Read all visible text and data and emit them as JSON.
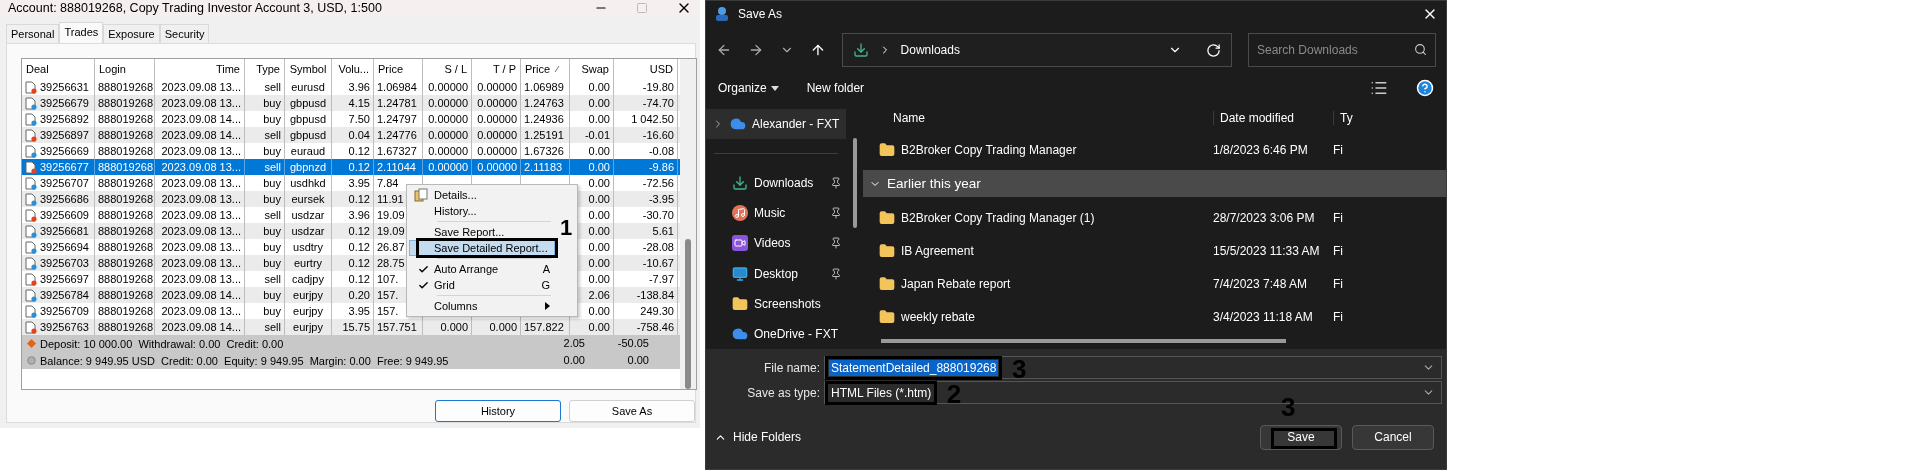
{
  "account_window": {
    "title": "Account: 888019268, Copy Trading Investor Account 3, USD, 1:500",
    "tabs": [
      {
        "label": "Personal",
        "selected": false
      },
      {
        "label": "Trades",
        "selected": true
      },
      {
        "label": "Exposure",
        "selected": false
      },
      {
        "label": "Security",
        "selected": false
      }
    ],
    "table": {
      "columns": [
        {
          "label": "Deal",
          "sorted": false
        },
        {
          "label": "Login",
          "sorted": false
        },
        {
          "label": "Time",
          "sorted": false
        },
        {
          "label": "Type",
          "sorted": false
        },
        {
          "label": "Symbol",
          "sorted": false
        },
        {
          "label": "Volu...",
          "sorted": false
        },
        {
          "label": "Price",
          "sorted": false
        },
        {
          "label": "S / L",
          "sorted": false
        },
        {
          "label": "T / P",
          "sorted": false
        },
        {
          "label": "Price",
          "sorted": true
        },
        {
          "label": "Swap",
          "sorted": false
        },
        {
          "label": "USD",
          "sorted": false
        }
      ],
      "rows": [
        {
          "selected": false,
          "color": "#e0461c",
          "cells": [
            "39256631",
            "888019268",
            "2023.09.08 13...",
            "sell",
            "eurusd",
            "3.96",
            "1.06984",
            "0.00000",
            "0.00000",
            "1.06989",
            "0.00",
            "-19.80"
          ]
        },
        {
          "selected": false,
          "color": "#2b8fd8",
          "cells": [
            "39256679",
            "888019268",
            "2023.09.08 13...",
            "buy",
            "gbpusd",
            "4.15",
            "1.24781",
            "0.00000",
            "0.00000",
            "1.24763",
            "0.00",
            "-74.70"
          ]
        },
        {
          "selected": false,
          "color": "#2b8fd8",
          "cells": [
            "39256892",
            "888019268",
            "2023.09.08 14...",
            "buy",
            "gbpusd",
            "7.50",
            "1.24797",
            "0.00000",
            "0.00000",
            "1.24936",
            "0.00",
            "1 042.50"
          ]
        },
        {
          "selected": false,
          "color": "#e0461c",
          "cells": [
            "39256897",
            "888019268",
            "2023.09.08 14...",
            "sell",
            "gbpusd",
            "0.04",
            "1.24776",
            "0.00000",
            "0.00000",
            "1.25191",
            "-0.01",
            "-16.60"
          ]
        },
        {
          "selected": false,
          "color": "#2b8fd8",
          "cells": [
            "39256669",
            "888019268",
            "2023.09.08 13...",
            "buy",
            "euraud",
            "0.12",
            "1.67327",
            "0.00000",
            "0.00000",
            "1.67326",
            "0.00",
            "-0.08"
          ]
        },
        {
          "selected": true,
          "color": "#e0461c",
          "cells": [
            "39256677",
            "888019268",
            "2023.09.08 13...",
            "sell",
            "gbpnzd",
            "0.12",
            "2.11044",
            "0.00000",
            "0.00000",
            "2.11183",
            "0.00",
            "-9.86"
          ]
        },
        {
          "selected": false,
          "color": "#2b8fd8",
          "cells": [
            "39256707",
            "888019268",
            "2023.09.08 13...",
            "buy",
            "usdhkd",
            "3.95",
            "7.84",
            null,
            null,
            null,
            "0.00",
            "-72.56"
          ]
        },
        {
          "selected": false,
          "color": "#2b8fd8",
          "cells": [
            "39256686",
            "888019268",
            "2023.09.08 13...",
            "buy",
            "eursek",
            "0.12",
            "11.91",
            null,
            null,
            null,
            "0.00",
            "-3.95"
          ]
        },
        {
          "selected": false,
          "color": "#e0461c",
          "cells": [
            "39256609",
            "888019268",
            "2023.09.08 13...",
            "sell",
            "usdzar",
            "3.96",
            "19.09",
            null,
            null,
            null,
            "0.00",
            "-30.70"
          ]
        },
        {
          "selected": false,
          "color": "#2b8fd8",
          "cells": [
            "39256681",
            "888019268",
            "2023.09.08 13...",
            "buy",
            "usdzar",
            "0.12",
            "19.09",
            null,
            null,
            null,
            "0.00",
            "5.61"
          ]
        },
        {
          "selected": false,
          "color": "#2b8fd8",
          "cells": [
            "39256694",
            "888019268",
            "2023.09.08 13...",
            "buy",
            "usdtry",
            "0.12",
            "26.87",
            null,
            null,
            null,
            "0.00",
            "-28.08"
          ]
        },
        {
          "selected": false,
          "color": "#2b8fd8",
          "cells": [
            "39256703",
            "888019268",
            "2023.09.08 13...",
            "buy",
            "eurtry",
            "0.12",
            "28.75",
            null,
            null,
            null,
            "0.00",
            "-10.67"
          ]
        },
        {
          "selected": false,
          "color": "#e0461c",
          "cells": [
            "39256697",
            "888019268",
            "2023.09.08 13...",
            "sell",
            "cadjpy",
            "0.12",
            "107.",
            null,
            null,
            null,
            "0.00",
            "-7.97"
          ]
        },
        {
          "selected": false,
          "color": "#2b8fd8",
          "cells": [
            "39256784",
            "888019268",
            "2023.09.08 14...",
            "buy",
            "eurjpy",
            "0.20",
            "157.",
            null,
            null,
            null,
            "2.06",
            "-138.84"
          ]
        },
        {
          "selected": false,
          "color": "#2b8fd8",
          "cells": [
            "39256709",
            "888019268",
            "2023.09.08 13...",
            "buy",
            "eurjpy",
            "3.95",
            "157.",
            null,
            null,
            null,
            "0.00",
            "249.30"
          ]
        },
        {
          "selected": false,
          "color": "#e0461c",
          "cells": [
            "39256763",
            "888019268",
            "2023.09.08 14...",
            "sell",
            "eurjpy",
            "15.75",
            "157.751",
            "0.000",
            "0.000",
            "157.822",
            "0.00",
            "-758.46"
          ]
        }
      ],
      "summary": [
        {
          "kind": "deposit",
          "text": "Deposit: 10 000.00  Withdrawal: 0.00  Credit: 0.00",
          "swap": "2.05",
          "usd": "-50.05"
        },
        {
          "kind": "balance",
          "text": "Balance: 9 949.95 USD  Credit: 0.00  Equity: 9 949.95  Margin: 0.00  Free: 9 949.95",
          "swap": "0.00",
          "usd": "0.00"
        }
      ]
    },
    "context_menu": {
      "items": [
        {
          "kind": "item",
          "label": "Details...",
          "icon": true,
          "checked": false,
          "highlighted": false,
          "outlined": false
        },
        {
          "kind": "item",
          "label": "History...",
          "icon": false,
          "checked": false,
          "highlighted": false,
          "outlined": false
        },
        {
          "kind": "separator"
        },
        {
          "kind": "item",
          "label": "Save Report...",
          "icon": false,
          "checked": false,
          "highlighted": false,
          "outlined": false
        },
        {
          "kind": "item",
          "label": "Save Detailed Report...",
          "icon": false,
          "checked": false,
          "highlighted": true,
          "outlined": true,
          "annotation": "1"
        },
        {
          "kind": "separator"
        },
        {
          "kind": "item",
          "label": "Auto Arrange",
          "icon": false,
          "checked": true,
          "highlighted": false,
          "outlined": false,
          "shortcut": "A"
        },
        {
          "kind": "item",
          "label": "Grid",
          "icon": false,
          "checked": true,
          "highlighted": false,
          "outlined": false,
          "shortcut": "G"
        },
        {
          "kind": "separator"
        },
        {
          "kind": "submenu",
          "label": "Columns",
          "icon": false,
          "checked": false,
          "highlighted": false,
          "outlined": false
        }
      ]
    },
    "buttons": [
      {
        "label": "History",
        "focused": true
      },
      {
        "label": "Save As",
        "focused": false
      }
    ]
  },
  "save_dialog": {
    "title": "Save As",
    "address": "Downloads",
    "search": {
      "placeholder": "Search Downloads"
    },
    "toolbar": [
      "Organize",
      "New folder"
    ],
    "sidebar": [
      {
        "kind": "cloud",
        "label": "Alexander - FXT",
        "pinned": false,
        "expander": true,
        "selected": true
      },
      {
        "kind": "separator"
      },
      {
        "kind": "download",
        "label": "Downloads",
        "pinned": true,
        "expander": false,
        "selected": false
      },
      {
        "kind": "music",
        "label": "Music",
        "pinned": true,
        "expander": false,
        "selected": false
      },
      {
        "kind": "video",
        "label": "Videos",
        "pinned": true,
        "expander": false,
        "selected": false
      },
      {
        "kind": "desktop",
        "label": "Desktop",
        "pinned": true,
        "expander": false,
        "selected": false
      },
      {
        "kind": "folder",
        "label": "Screenshots",
        "pinned": false,
        "expander": false,
        "selected": false
      },
      {
        "kind": "cloud",
        "label": "OneDrive - FXT",
        "pinned": false,
        "expander": false,
        "selected": false
      }
    ],
    "columns": [
      "Name",
      "Date modified",
      "Ty"
    ],
    "files": [
      {
        "kind": "file",
        "name": "B2Broker Copy Trading Manager",
        "date": "1/8/2023 6:46 PM",
        "type": "Fi"
      },
      {
        "kind": "group",
        "name": "Earlier this year",
        "expanded": true
      },
      {
        "kind": "file",
        "name": "B2Broker Copy Trading Manager (1)",
        "date": "28/7/2023 3:06 PM",
        "type": "Fi"
      },
      {
        "kind": "file",
        "name": "IB Agreement",
        "date": "15/5/2023 11:33 AM",
        "type": "Fi"
      },
      {
        "kind": "file",
        "name": "Japan Rebate report",
        "date": "7/4/2023 7:48 AM",
        "type": "Fi"
      },
      {
        "kind": "file",
        "name": "weekly rebate",
        "date": "3/4/2023 11:18 AM",
        "type": "Fi"
      }
    ],
    "file_name": {
      "label": "File name:",
      "value": "StatementDetailed_888019268",
      "outlined": true,
      "annotation": "3"
    },
    "save_type": {
      "label": "Save as type:",
      "value": "HTML Files (*.htm)",
      "outlined": true,
      "annotation": "2"
    },
    "hide_folders": "Hide Folders",
    "buttons": [
      {
        "label": "Save",
        "outlined": true,
        "annotation": "3"
      },
      {
        "label": "Cancel",
        "outlined": false
      }
    ]
  }
}
